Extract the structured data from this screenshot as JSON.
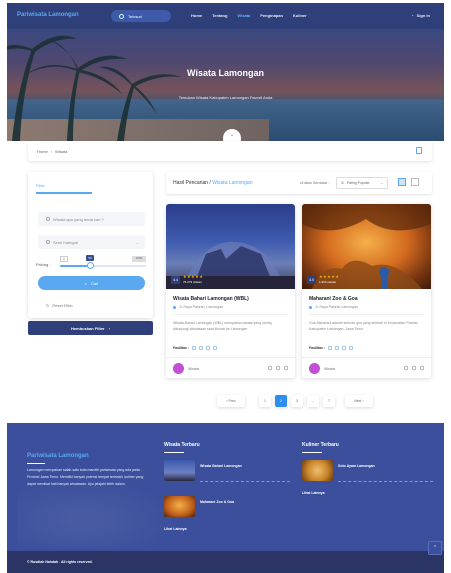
{
  "navbar": {
    "brand": "Pariwisata Lamongan",
    "search_label": "Telusuri",
    "menu": [
      {
        "label": "Home",
        "active": false
      },
      {
        "label": "Tentang",
        "active": false
      },
      {
        "label": "Wisata",
        "active": true
      },
      {
        "label": "Penginapan",
        "active": false
      },
      {
        "label": "Kuliner",
        "active": false
      }
    ],
    "signin": "Sign in"
  },
  "hero": {
    "title": "Wisata Lamongan",
    "subtitle": "Temukan Wisata Kabupaten Lamongan Favorit Anda"
  },
  "breadcrumb": [
    "Home",
    "›",
    "Wisata"
  ],
  "filter": {
    "tab": "Filter",
    "search_placeholder": "Wisata apa yang anda cari ?",
    "category_placeholder": "Semi Kategori",
    "price_label": "Pricing :",
    "price_min": "0",
    "price_bubble": "50",
    "price_max": "1000",
    "price_level": 0.35,
    "search_button": "Cari",
    "reset": "Reset Filter",
    "fold_button": "Hembuskan Filter"
  },
  "results": {
    "title_prefix": "Hasil Pencarian / ",
    "title_highlight": "Wisata Lamongan",
    "sort_label": "Urutkan Berdasar :",
    "sort_value": "Paling Populer"
  },
  "cards": [
    {
      "rating": "4.4",
      "stars": "★★★★★",
      "reviews": "76.279 ulasan",
      "title": "Wisata Bahari Lamongan (WBL)",
      "location": "Jl. Raya Paciran, Lamongan",
      "description": "Wisata Bahari Lamongan (WBL) merupakan wisata yang sering dikunjungi wisatawan saat liburan ke Lamongan",
      "facilities_label": "Fasilitas :",
      "category": "Wisata"
    },
    {
      "rating": "4.5",
      "stars": "★★★★★",
      "reviews": "1.934 ulasan",
      "title": "Maharani Zoo & Goa",
      "location": "Jl. Raya Paciran Lamongan",
      "description": "Goa Maharani adalah sebuah goa yang terletak di Kecamatan Paciran Kabupaten Lamongan, Jawa Timur",
      "facilities_label": "Fasilitas :",
      "category": "Wisata"
    }
  ],
  "pagination": {
    "prev": "‹ Prev",
    "pages": [
      "1",
      "2",
      "3",
      "...",
      "7"
    ],
    "active_page": "2",
    "next": "Next ›"
  },
  "footer": {
    "brand": "Pariwisata Lamongan",
    "about": "Lamongan merupakan salah satu kota mandiri pariwisata yang ada pada Provinsi Jawa Timur. Memiliki banyak potensi tempat terindah, kuliner yang dapat memikat hati banyak wisatawan. Ayo jelajahi lebih dalam.",
    "col_wisata": {
      "title": "Wisata Terbaru",
      "items": [
        "Wisata Bahari Lamongan",
        "Maharani Zoo & Goa"
      ],
      "more": "Lihat Lainnya"
    },
    "col_kuliner": {
      "title": "Kuliner Terbaru",
      "items": [
        "Soto Ayam Lamongan"
      ],
      "more": "Lihat Lainnya"
    },
    "copyright": "© Rusdiah Nahdah . All rights reserved.",
    "to_top": "⌃"
  },
  "colors": {
    "navy": "#2f3f7a",
    "accent": "#5aa9f0",
    "footer": "#3b4f9c"
  }
}
